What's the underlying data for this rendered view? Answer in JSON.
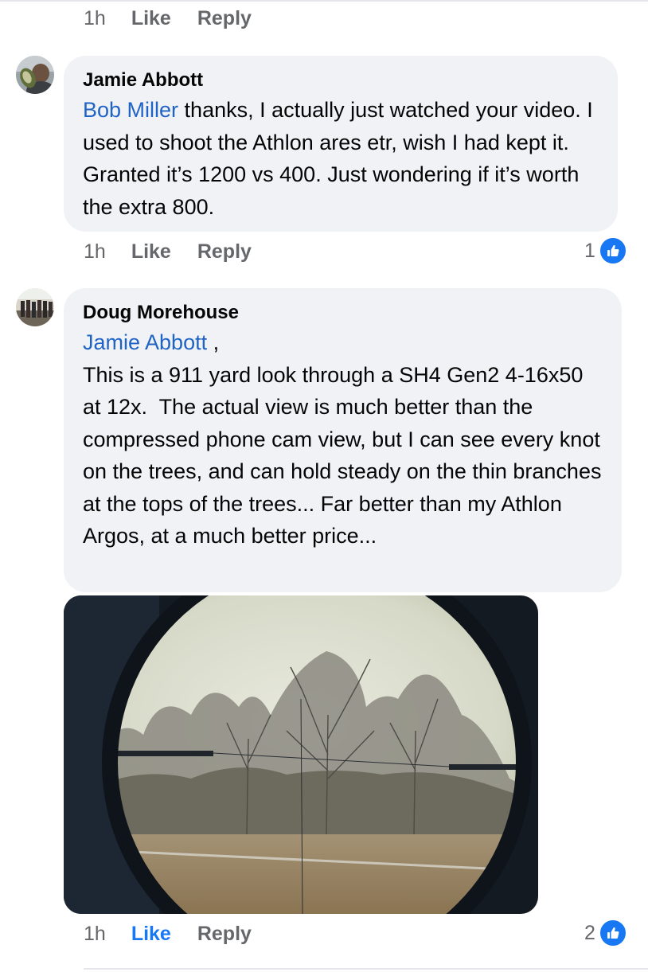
{
  "previous_comment": {
    "time": "1h",
    "like_label": "Like",
    "reply_label": "Reply"
  },
  "comments": [
    {
      "author": "Jamie Abbott",
      "mention": "Bob Miller",
      "text": " thanks, I actually just watched your video. I used to shoot the Athlon ares etr, wish I had kept it. Granted it’s 1200 vs 400. Just wondering if it’s worth the extra 800.",
      "time": "1h",
      "like_label": "Like",
      "reply_label": "Reply",
      "reaction_count": "1",
      "liked": false
    },
    {
      "author": "Doug Morehouse",
      "mention": "Jamie Abbott",
      "mention_suffix": " ,",
      "text": "This is a 911 yard look through a SH4 Gen2 4-16x50 at 12x.  The actual view is much better than the compressed phone cam view, but I can see every knot on the trees, and can hold steady on the thin branches at the tops of the trees... Far better than my Athlon Argos, at a much better price...",
      "time": "1h",
      "like_label": "Like",
      "reply_label": "Reply",
      "reaction_count": "2",
      "liked": true
    }
  ],
  "icons": {
    "reaction": "thumbs-up-icon"
  },
  "colors": {
    "link": "#1f63c4",
    "like_blue": "#1877f2",
    "meta_gray": "#65676b",
    "bubble": "#f0f2f5"
  }
}
